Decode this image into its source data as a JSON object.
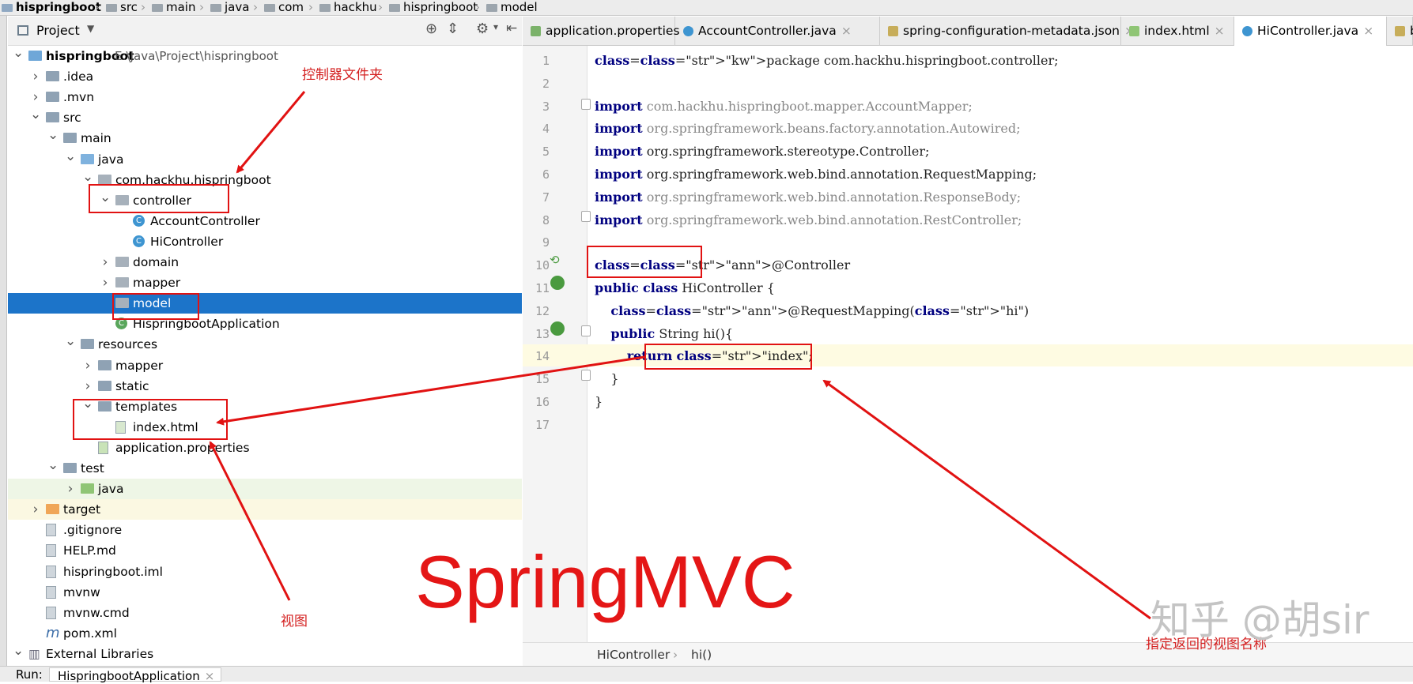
{
  "breadcrumb": [
    "hispringboot",
    "src",
    "main",
    "java",
    "com",
    "hackhu",
    "hispringboot",
    "model"
  ],
  "project_panel": {
    "title": "Project",
    "root_name": "hispringboot",
    "root_path": "E:\\Java\\Project\\hispringboot"
  },
  "tree": [
    {
      "label": "hispringboot",
      "depth": 0,
      "icon": "module-folder-icon",
      "chevron": "open"
    },
    {
      "label": ".idea",
      "depth": 1,
      "icon": "folder-icon",
      "chevron": "closed"
    },
    {
      "label": ".mvn",
      "depth": 1,
      "icon": "folder-icon",
      "chevron": "closed"
    },
    {
      "label": "src",
      "depth": 1,
      "icon": "folder-icon",
      "chevron": "open"
    },
    {
      "label": "main",
      "depth": 2,
      "icon": "folder-icon",
      "chevron": "open"
    },
    {
      "label": "java",
      "depth": 3,
      "icon": "source-folder-icon",
      "chevron": "open"
    },
    {
      "label": "com.hackhu.hispringboot",
      "depth": 4,
      "icon": "package-icon",
      "chevron": "open"
    },
    {
      "label": "controller",
      "depth": 5,
      "icon": "package-icon",
      "chevron": "open"
    },
    {
      "label": "AccountController",
      "depth": 6,
      "icon": "class-icon",
      "chevron": "none"
    },
    {
      "label": "HiController",
      "depth": 6,
      "icon": "class-icon",
      "chevron": "none"
    },
    {
      "label": "domain",
      "depth": 5,
      "icon": "package-icon",
      "chevron": "closed"
    },
    {
      "label": "mapper",
      "depth": 5,
      "icon": "package-icon",
      "chevron": "closed"
    },
    {
      "label": "model",
      "depth": 5,
      "icon": "package-icon",
      "chevron": "none",
      "selected": true
    },
    {
      "label": "HispringbootApplication",
      "depth": 5,
      "icon": "spring-class-icon",
      "chevron": "none"
    },
    {
      "label": "resources",
      "depth": 3,
      "icon": "resources-folder-icon",
      "chevron": "open"
    },
    {
      "label": "mapper",
      "depth": 4,
      "icon": "folder-icon",
      "chevron": "closed"
    },
    {
      "label": "static",
      "depth": 4,
      "icon": "folder-icon",
      "chevron": "closed"
    },
    {
      "label": "templates",
      "depth": 4,
      "icon": "folder-icon",
      "chevron": "open"
    },
    {
      "label": "index.html",
      "depth": 5,
      "icon": "html-file-icon",
      "chevron": "none"
    },
    {
      "label": "application.properties",
      "depth": 4,
      "icon": "properties-file-icon",
      "chevron": "none"
    },
    {
      "label": "test",
      "depth": 2,
      "icon": "folder-icon",
      "chevron": "open"
    },
    {
      "label": "java",
      "depth": 3,
      "icon": "test-folder-icon",
      "chevron": "closed",
      "highlight": "green"
    },
    {
      "label": "target",
      "depth": 1,
      "icon": "excluded-folder-icon",
      "chevron": "closed",
      "highlight": "yellow"
    },
    {
      "label": ".gitignore",
      "depth": 1,
      "icon": "file-icon",
      "chevron": "none"
    },
    {
      "label": "HELP.md",
      "depth": 1,
      "icon": "md-file-icon",
      "chevron": "none"
    },
    {
      "label": "hispringboot.iml",
      "depth": 1,
      "icon": "file-icon",
      "chevron": "none"
    },
    {
      "label": "mvnw",
      "depth": 1,
      "icon": "file-icon",
      "chevron": "none"
    },
    {
      "label": "mvnw.cmd",
      "depth": 1,
      "icon": "file-icon",
      "chevron": "none"
    },
    {
      "label": "pom.xml",
      "depth": 1,
      "icon": "maven-icon",
      "chevron": "none"
    },
    {
      "label": "External Libraries",
      "depth": 0,
      "icon": "library-icon",
      "chevron": "open"
    }
  ],
  "tabs": [
    {
      "label": "application.properties",
      "active": false
    },
    {
      "label": "AccountController.java",
      "active": false
    },
    {
      "label": "spring-configuration-metadata.json",
      "active": false
    },
    {
      "label": "index.html",
      "active": false
    },
    {
      "label": "HiController.java",
      "active": true
    },
    {
      "label": "b",
      "active": false
    }
  ],
  "code_lines": [
    {
      "n": "1",
      "text": "package com.hackhu.hispringboot.controller;"
    },
    {
      "n": "2",
      "text": ""
    },
    {
      "n": "3",
      "text": "import com.hackhu.hispringboot.mapper.AccountMapper;"
    },
    {
      "n": "4",
      "text": "import org.springframework.beans.factory.annotation.Autowired;"
    },
    {
      "n": "5",
      "text": "import org.springframework.stereotype.Controller;"
    },
    {
      "n": "6",
      "text": "import org.springframework.web.bind.annotation.RequestMapping;"
    },
    {
      "n": "7",
      "text": "import org.springframework.web.bind.annotation.ResponseBody;"
    },
    {
      "n": "8",
      "text": "import org.springframework.web.bind.annotation.RestController;"
    },
    {
      "n": "9",
      "text": ""
    },
    {
      "n": "10",
      "text": "@Controller"
    },
    {
      "n": "11",
      "text": "public class HiController {"
    },
    {
      "n": "12",
      "text": "    @RequestMapping(\"hi\")"
    },
    {
      "n": "13",
      "text": "    public String hi(){"
    },
    {
      "n": "14",
      "text": "        return \"index\";"
    },
    {
      "n": "15",
      "text": "    }"
    },
    {
      "n": "16",
      "text": "}"
    },
    {
      "n": "17",
      "text": ""
    }
  ],
  "editor_breadcrumb": {
    "class": "HiController",
    "method": "hi()"
  },
  "run_bar": {
    "label": "Run:",
    "config": "HispringbootApplication"
  },
  "annotations": {
    "controller_folder": "控制器文件夹",
    "view": "视图",
    "view_name": "指定返回的视图名称",
    "big_title": "SpringMVC",
    "watermark": "知乎 @胡sir"
  },
  "colors": {
    "selection": "#1c74c9",
    "annotation_red": "#e11212",
    "keyword": "#000080",
    "string": "#008000"
  }
}
